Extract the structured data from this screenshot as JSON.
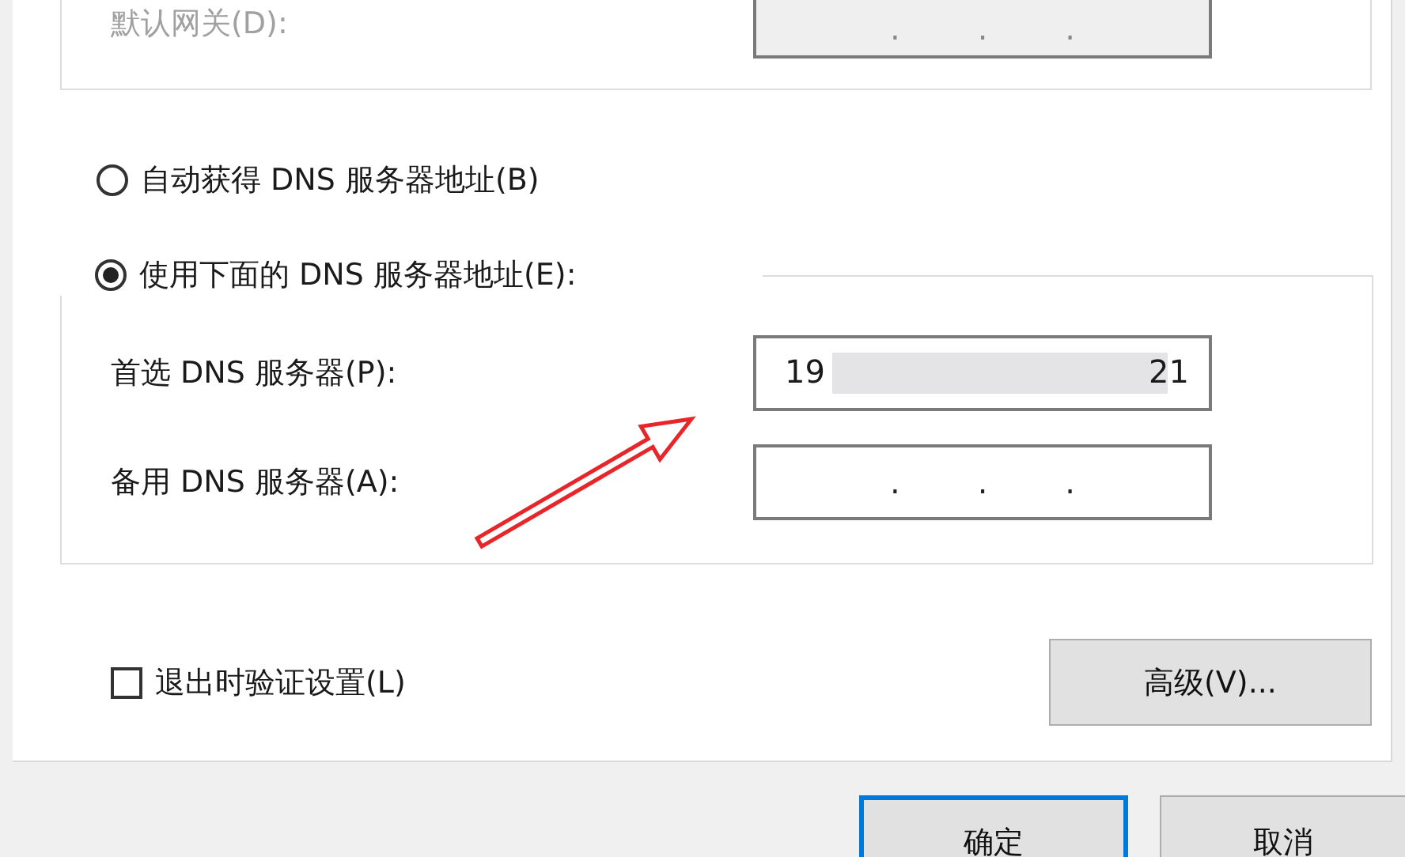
{
  "gateway": {
    "label": "默认网关(D):",
    "disabled": true,
    "dots": [
      ".",
      ".",
      "."
    ]
  },
  "dns_mode": [
    {
      "label": "自动获得 DNS 服务器地址(B)",
      "selected": false
    },
    {
      "label": "使用下面的 DNS 服务器地址(E):",
      "selected": true
    }
  ],
  "dns_fields": [
    {
      "label": "首选 DNS 服务器(P):",
      "kind": "redacted",
      "start": "19",
      "end": "21"
    },
    {
      "label": "备用 DNS 服务器(A):",
      "kind": "empty",
      "dots": [
        ".",
        ".",
        "."
      ]
    }
  ],
  "validate": {
    "label": "退出时验证设置(L)",
    "checked": false
  },
  "advanced_button": "高级(V)...",
  "buttons": [
    {
      "label": "确定",
      "default": true
    },
    {
      "label": "取消",
      "default": false
    }
  ]
}
